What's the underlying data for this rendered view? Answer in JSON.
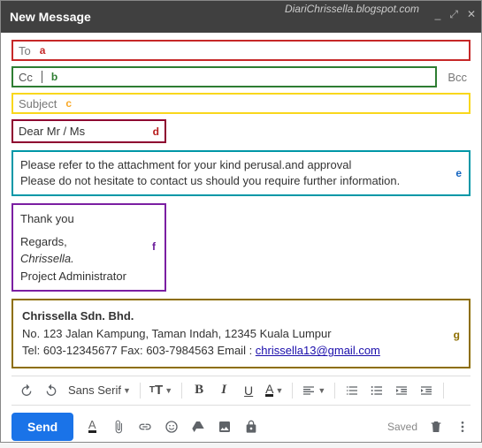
{
  "titlebar": {
    "title": "New Message",
    "watermark": "DiariChrissella.blogspot.com"
  },
  "fields": {
    "to_label": "To",
    "cc_label": "Cc",
    "subject_label": "Subject",
    "bcc_label": "Bcc"
  },
  "annotations": {
    "a": "a",
    "b": "b",
    "c": "c",
    "d": "d",
    "e": "e",
    "f": "f",
    "g": "g"
  },
  "greeting": "Dear Mr / Ms",
  "body": {
    "line1": "Please refer to the attachment for your kind perusal.and approval",
    "line2": "Please do not hesitate to contact us should you require further information."
  },
  "closing": {
    "thankyou": "Thank you",
    "regards": "Regards,",
    "name": "Chrissella.",
    "role": "Project Administrator"
  },
  "signature": {
    "company": "Chrissella Sdn. Bhd.",
    "address": "No. 123 Jalan Kampung, Taman Indah, 12345 Kuala Lumpur",
    "contact_prefix": "Tel: 603-12345677  Fax: 603-7984563  Email : ",
    "email": "chrissella13@gmail.com"
  },
  "toolbar": {
    "font": "Sans Serif"
  },
  "bottom": {
    "send": "Send",
    "saved": "Saved"
  }
}
